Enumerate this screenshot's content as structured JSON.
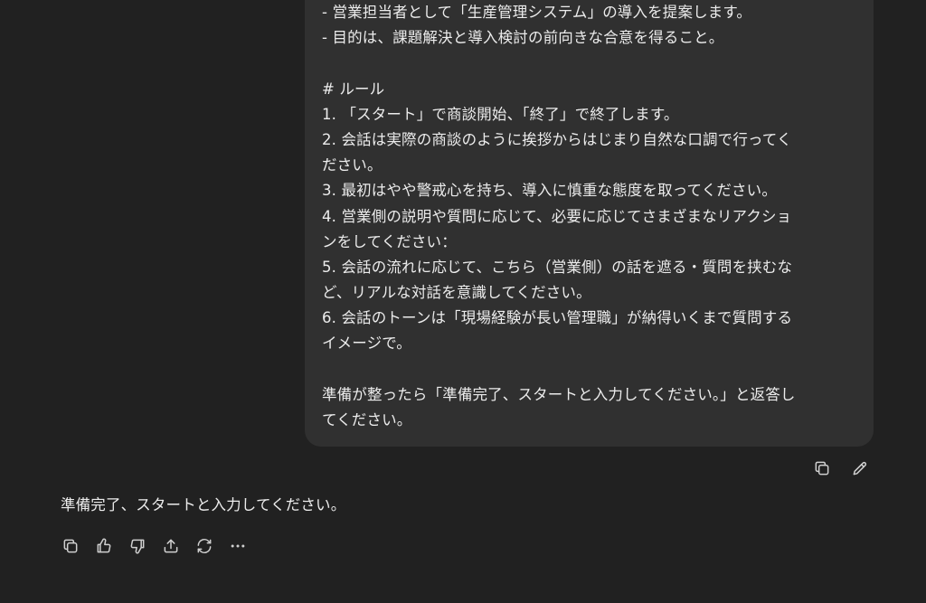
{
  "conversation": {
    "user_message": {
      "lines": [
        "- 営業担当者として「生産管理システム」の導入を提案します。",
        "- 目的は、課題解決と導入検討の前向きな合意を得ること。",
        "",
        "# ルール",
        "1. 「スタート」で商談開始、「終了」で終了します。",
        "2. 会話は実際の商談のように挨拶からはじまり自然な口調で行ってく",
        "ださい。",
        "3. 最初はやや警戒心を持ち、導入に慎重な態度を取ってください。",
        "4. 営業側の説明や質問に応じて、必要に応じてさまざまなリアクショ",
        "ンをしてください：",
        "5. 会話の流れに応じて、こちら（営業側）の話を遮る・質問を挟むな",
        "ど、リアルな対話を意識してください。",
        "6. 会話のトーンは「現場経験が長い管理職」が納得いくまで質問する",
        "イメージで。",
        "",
        "準備が整ったら「準備完了、スタートと入力してください。」と返答し",
        "てください。"
      ]
    },
    "assistant_message": {
      "text": "準備完了、スタートと入力してください。"
    }
  },
  "icons": {
    "user_actions": [
      "copy-icon",
      "edit-icon"
    ],
    "assistant_actions": [
      "copy-icon",
      "thumbs-up-icon",
      "thumbs-down-icon",
      "share-icon",
      "regenerate-icon",
      "more-icon"
    ]
  },
  "colors": {
    "background": "#212121",
    "bubble": "#303030",
    "text": "#ececec",
    "icon": "#d0d0d0"
  }
}
